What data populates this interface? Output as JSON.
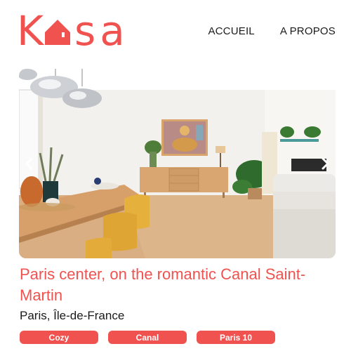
{
  "logo": {
    "first_letter": "K",
    "rest": "sa",
    "icon": "house-icon",
    "color": "#f0524f"
  },
  "nav": {
    "items": [
      {
        "label": "ACCUEIL"
      },
      {
        "label": "A PROPOS"
      }
    ]
  },
  "carousel": {
    "image": "apartment-living-room-photo",
    "prev_icon": "chevron-left-icon",
    "next_icon": "chevron-right-icon"
  },
  "listing": {
    "title": "Paris center, on the romantic Canal Saint-Martin",
    "location": "Paris, Île-de-France",
    "tags": [
      "Cozy",
      "Canal",
      "Paris 10"
    ]
  },
  "colors": {
    "accent": "#f0524f",
    "text": "#1a1a1a"
  }
}
